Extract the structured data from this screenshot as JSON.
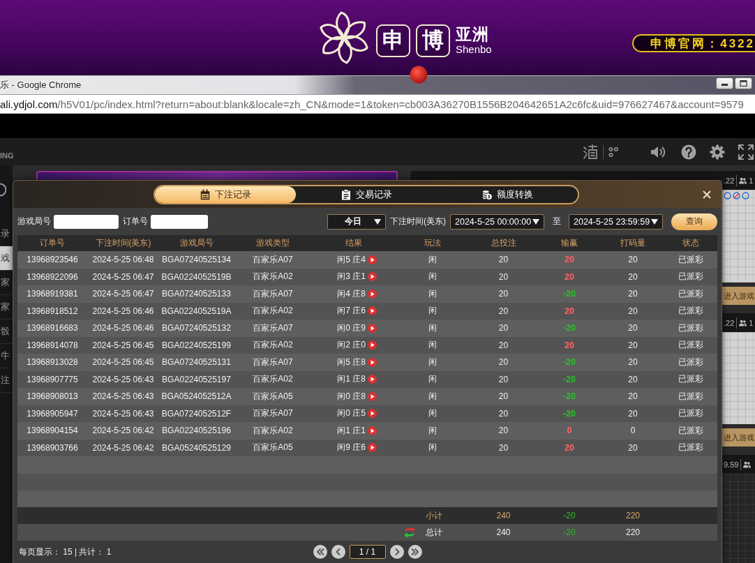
{
  "banner": {
    "logo_chars": [
      "申",
      "博"
    ],
    "logo_title": "亚洲",
    "logo_subtitle": "Shenbo",
    "site_notice": "申博官网：4322"
  },
  "browser": {
    "title": "乐 - Google Chrome",
    "url_host": "ali.ydjol.com",
    "url_path": "/h5V01/pc/index.html?return=about:blank&locale=zh_CN&mode=1&token=cb003A36270B1556B204642651A2c6fc&uid=976627467&account=9579"
  },
  "game_header": {
    "brand": "ING"
  },
  "sidebar": {
    "items": [
      {
        "label": "录",
        "selected": false
      },
      {
        "label": "戏",
        "selected": true
      },
      {
        "label": "家",
        "selected": false
      },
      {
        "label": "家",
        "selected": false
      },
      {
        "label": "骰",
        "selected": false
      },
      {
        "label": "牛",
        "selected": false
      },
      {
        "label": "注",
        "selected": false
      }
    ]
  },
  "side_panels": [
    {
      "kind": "stat",
      "value": ".22",
      "count": "1"
    },
    {
      "kind": "roadmap"
    },
    {
      "kind": "enter",
      "label": "进入游戏"
    },
    {
      "kind": "stat",
      "value": ".22",
      "count": "1"
    },
    {
      "kind": "board"
    },
    {
      "kind": "enter",
      "label": "进入游戏"
    },
    {
      "kind": "stat",
      "value": "9.59"
    },
    {
      "kind": "grid"
    }
  ],
  "dialog": {
    "tabs": [
      {
        "label": "下注记录",
        "selected": true
      },
      {
        "label": "交易记录",
        "selected": false
      },
      {
        "label": "额度转换",
        "selected": false
      }
    ],
    "filters": {
      "round_label": "游戏局号",
      "order_label": "订单号",
      "period": "今日",
      "time_label": "下注时间(美东)",
      "start": "2024-5-25 00:00:00",
      "to_label": "至",
      "end": "2024-5-25 23:59:59",
      "query_button": "查询"
    },
    "table": {
      "columns": [
        "订单号",
        "下注时间(美东)",
        "游戏局号",
        "游戏类型",
        "结果",
        "玩法",
        "总投注",
        "输赢",
        "打码量",
        "状态"
      ],
      "rows": [
        {
          "order": "13968923546",
          "time": "2024-5-25 06:48",
          "round": "BGA07240525134",
          "game": "百家乐A07",
          "result": "闲5 庄4",
          "bet_type": "闲",
          "total_bet": "20",
          "win_loss": {
            "value": "20",
            "color": "#ff6464"
          },
          "turnover": "20",
          "status": "已派彩"
        },
        {
          "order": "13968922096",
          "time": "2024-5-25 06:47",
          "round": "BGA0224052519B",
          "game": "百家乐A02",
          "result": "闲3 庄1",
          "bet_type": "闲",
          "total_bet": "20",
          "win_loss": {
            "value": "20",
            "color": "#ff6464"
          },
          "turnover": "20",
          "status": "已派彩"
        },
        {
          "order": "13968919381",
          "time": "2024-5-25 06:47",
          "round": "BGA07240525133",
          "game": "百家乐A07",
          "result": "闲4 庄8",
          "bet_type": "闲",
          "total_bet": "20",
          "win_loss": {
            "value": "-20",
            "color": "#27c427"
          },
          "turnover": "20",
          "status": "已派彩"
        },
        {
          "order": "13968918512",
          "time": "2024-5-25 06:46",
          "round": "BGA0224052519A",
          "game": "百家乐A02",
          "result": "闲7 庄6",
          "bet_type": "闲",
          "total_bet": "20",
          "win_loss": {
            "value": "20",
            "color": "#ff6464"
          },
          "turnover": "20",
          "status": "已派彩"
        },
        {
          "order": "13968916683",
          "time": "2024-5-25 06:46",
          "round": "BGA07240525132",
          "game": "百家乐A07",
          "result": "闲0 庄9",
          "bet_type": "闲",
          "total_bet": "20",
          "win_loss": {
            "value": "-20",
            "color": "#27c427"
          },
          "turnover": "20",
          "status": "已派彩"
        },
        {
          "order": "13968914078",
          "time": "2024-5-25 06:45",
          "round": "BGA02240525199",
          "game": "百家乐A02",
          "result": "闲2 庄0",
          "bet_type": "闲",
          "total_bet": "20",
          "win_loss": {
            "value": "20",
            "color": "#ff6464"
          },
          "turnover": "20",
          "status": "已派彩"
        },
        {
          "order": "13968913028",
          "time": "2024-5-25 06:45",
          "round": "BGA07240525131",
          "game": "百家乐A07",
          "result": "闲5 庄8",
          "bet_type": "闲",
          "total_bet": "20",
          "win_loss": {
            "value": "-20",
            "color": "#27c427"
          },
          "turnover": "20",
          "status": "已派彩"
        },
        {
          "order": "13968907775",
          "time": "2024-5-25 06:43",
          "round": "BGA02240525197",
          "game": "百家乐A02",
          "result": "闲1 庄8",
          "bet_type": "闲",
          "total_bet": "20",
          "win_loss": {
            "value": "-20",
            "color": "#27c427"
          },
          "turnover": "20",
          "status": "已派彩"
        },
        {
          "order": "13968908013",
          "time": "2024-5-25 06:43",
          "round": "BGA0524052512A",
          "game": "百家乐A05",
          "result": "闲0 庄8",
          "bet_type": "闲",
          "total_bet": "20",
          "win_loss": {
            "value": "-20",
            "color": "#27c427"
          },
          "turnover": "20",
          "status": "已派彩"
        },
        {
          "order": "13968905947",
          "time": "2024-5-25 06:43",
          "round": "BGA0724052512F",
          "game": "百家乐A07",
          "result": "闲0 庄5",
          "bet_type": "闲",
          "total_bet": "20",
          "win_loss": {
            "value": "-20",
            "color": "#27c427"
          },
          "turnover": "20",
          "status": "已派彩"
        },
        {
          "order": "13968904154",
          "time": "2024-5-25 06:42",
          "round": "BGA02240525196",
          "game": "百家乐A02",
          "result": "闲1 庄1",
          "bet_type": "闲",
          "total_bet": "20",
          "win_loss": {
            "value": "0",
            "color": "#ff6464"
          },
          "turnover": "0",
          "status": "已派彩"
        },
        {
          "order": "13968903766",
          "time": "2024-5-25 06:42",
          "round": "BGA05240525129",
          "game": "百家乐A05",
          "result": "闲9 庄6",
          "bet_type": "闲",
          "total_bet": "20",
          "win_loss": {
            "value": "20",
            "color": "#ff6464"
          },
          "turnover": "20",
          "status": "已派彩"
        }
      ],
      "summary": [
        {
          "kind": "subtotal",
          "label": "小计",
          "total_bet": "240",
          "win_loss": {
            "value": "-20",
            "color": "#27c427"
          },
          "turnover": "220"
        },
        {
          "kind": "total",
          "label": "总计",
          "total_bet": "240",
          "win_loss": {
            "value": "-20",
            "color": "#27c427"
          },
          "turnover": "220"
        }
      ]
    },
    "footer": {
      "page_info": "每页显示： 15 | 共计： 1",
      "page": "1 / 1"
    }
  }
}
